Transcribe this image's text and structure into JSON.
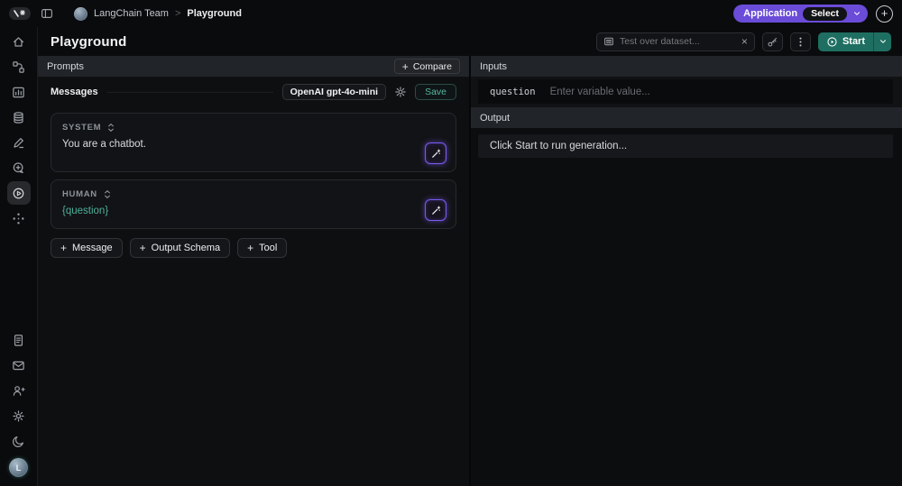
{
  "icons": {
    "plus": "+",
    "close": "×",
    "breadcrumb_separator": ">"
  },
  "topbar": {
    "team_name": "LangChain Team",
    "page_name": "Playground",
    "application_label": "Application",
    "select_label": "Select"
  },
  "header": {
    "title": "Playground",
    "dataset_placeholder": "Test over dataset...",
    "start_label": "Start"
  },
  "prompts": {
    "panel_title": "Prompts",
    "compare_label": "Compare",
    "messages_label": "Messages",
    "model_label": "OpenAI gpt-4o-mini",
    "save_label": "Save",
    "system_role": "SYSTEM",
    "system_content": "You are a chatbot.",
    "human_role": "HUMAN",
    "human_content": "{question}",
    "add_message_label": "Message",
    "add_output_schema_label": "Output Schema",
    "add_tool_label": "Tool"
  },
  "io": {
    "inputs_title": "Inputs",
    "variable_name": "question",
    "variable_placeholder": "Enter variable value...",
    "output_title": "Output",
    "output_hint": "Click Start to run generation..."
  },
  "user": {
    "avatar_initial": "L"
  },
  "colors": {
    "accent_purple": "#6a4cd8",
    "accent_teal": "#1e6f61",
    "teal_text": "#57b7a0",
    "variable_text": "#4fb09a",
    "wand_border": "#7b5af0"
  }
}
